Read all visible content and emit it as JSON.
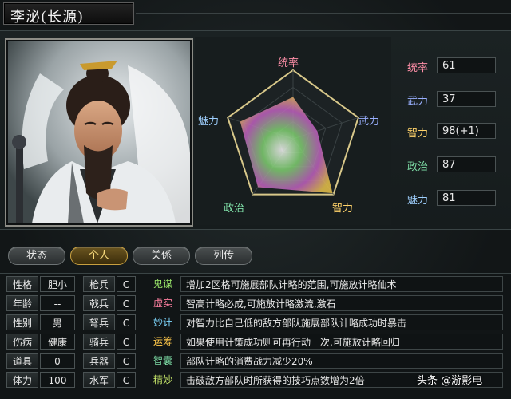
{
  "header": {
    "title": "李泌(长源)"
  },
  "radar": {
    "labels": {
      "top": "统率",
      "right": "武力",
      "bottom_right": "智力",
      "bottom_left": "政治",
      "left": "魅力"
    },
    "values": {
      "统率": 61,
      "武力": 37,
      "智力": 98,
      "政治": 87,
      "魅力": 81
    },
    "max": 100
  },
  "stats": [
    {
      "name": "统率",
      "value": "61",
      "color": "#ff8fa8"
    },
    {
      "name": "武力",
      "value": "37",
      "color": "#9ab0ff"
    },
    {
      "name": "智力",
      "value": "98(+1)",
      "color": "#ffd36a"
    },
    {
      "name": "政治",
      "value": "87",
      "color": "#7fe0a8"
    },
    {
      "name": "魅力",
      "value": "81",
      "color": "#9fd0ff"
    }
  ],
  "tabs": [
    {
      "label": "状态",
      "active": false
    },
    {
      "label": "个人",
      "active": true
    },
    {
      "label": "关係",
      "active": false
    },
    {
      "label": "列传",
      "active": false
    }
  ],
  "profile": {
    "rows": [
      {
        "label": "性格",
        "value": "胆小",
        "troop": "枪兵",
        "grade": "C"
      },
      {
        "label": "年龄",
        "value": "--",
        "troop": "戟兵",
        "grade": "C"
      },
      {
        "label": "性别",
        "value": "男",
        "troop": "弩兵",
        "grade": "C"
      },
      {
        "label": "伤病",
        "value": "健康",
        "troop": "骑兵",
        "grade": "C"
      },
      {
        "label": "道具",
        "value": "0",
        "troop": "兵器",
        "grade": "C"
      },
      {
        "label": "体力",
        "value": "100",
        "troop": "水军",
        "grade": "C"
      }
    ]
  },
  "skills": [
    {
      "name": "鬼谋",
      "color": "#9be86a",
      "desc": "增加2区格可施展部队计略的范围,可施放计略仙术"
    },
    {
      "name": "虚实",
      "color": "#ff7fa0",
      "desc": "智高计略必成,可施放计略激流,激石"
    },
    {
      "name": "妙计",
      "color": "#7fd8ff",
      "desc": "对智力比自己低的敌方部队施展部队计略成功时暴击"
    },
    {
      "name": "运筹",
      "color": "#ffc84a",
      "desc": "如果使用计策成功则可再行动一次,可施放计略回归"
    },
    {
      "name": "智囊",
      "color": "#7fe0a8",
      "desc": "部队计略的消费战力减少20%"
    },
    {
      "name": "精妙",
      "color": "#c8e86a",
      "desc": "击破敌方部队时所获得的技巧点数增为2倍"
    }
  ],
  "watermark": "头条 @游影电"
}
